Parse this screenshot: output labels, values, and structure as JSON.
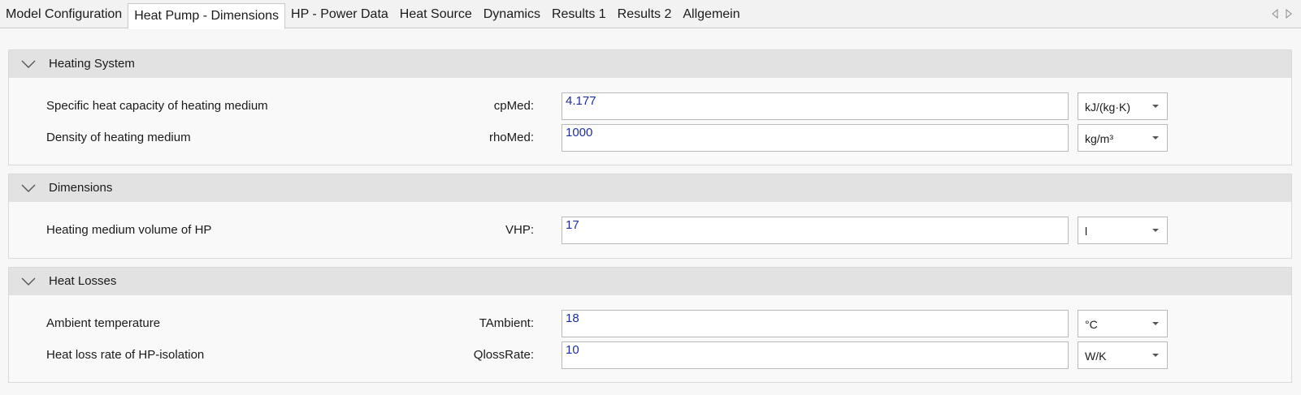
{
  "tabs": [
    {
      "label": "Model Configuration",
      "active": false
    },
    {
      "label": "Heat Pump - Dimensions",
      "active": true
    },
    {
      "label": "HP - Power Data",
      "active": false
    },
    {
      "label": "Heat Source",
      "active": false
    },
    {
      "label": "Dynamics",
      "active": false
    },
    {
      "label": "Results 1",
      "active": false
    },
    {
      "label": "Results 2",
      "active": false
    },
    {
      "label": "Allgemein",
      "active": false
    }
  ],
  "tab_scroll": {
    "left_icon": "triangle-left-icon",
    "right_icon": "triangle-right-icon"
  },
  "sections": [
    {
      "title": "Heating System",
      "expanded": true,
      "rows": [
        {
          "label": "Specific heat capacity of heating medium",
          "var": "cpMed:",
          "value": "4.177",
          "unit": "kJ/(kg·K)"
        },
        {
          "label": "Density of heating medium",
          "var": "rhoMed:",
          "value": "1000",
          "unit": "kg/m³"
        }
      ]
    },
    {
      "title": "Dimensions",
      "expanded": true,
      "rows": [
        {
          "label": "Heating medium volume of HP",
          "var": "VHP:",
          "value": "17",
          "unit": "l"
        }
      ]
    },
    {
      "title": "Heat Losses",
      "expanded": true,
      "rows": [
        {
          "label": "Ambient temperature",
          "var": "TAmbient:",
          "value": "18",
          "unit": "°C"
        },
        {
          "label": "Heat loss rate of HP-isolation",
          "var": "QlossRate:",
          "value": "10",
          "unit": "W/K"
        }
      ]
    }
  ],
  "colors": {
    "value_text": "#1e2f9e",
    "header_bg": "#e2e2e2"
  }
}
